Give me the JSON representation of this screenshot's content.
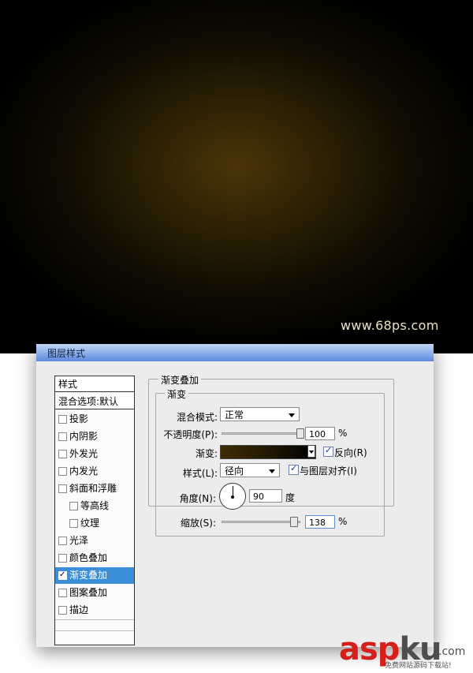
{
  "watermark_top": "www.68ps.com",
  "dialog": {
    "title": "图层样式",
    "styles_header": "样式",
    "blend_options": "混合选项:默认",
    "effects": [
      {
        "label": "投影",
        "checked": false,
        "indent": false,
        "selected": false
      },
      {
        "label": "内阴影",
        "checked": false,
        "indent": false,
        "selected": false
      },
      {
        "label": "外发光",
        "checked": false,
        "indent": false,
        "selected": false
      },
      {
        "label": "内发光",
        "checked": false,
        "indent": false,
        "selected": false
      },
      {
        "label": "斜面和浮雕",
        "checked": false,
        "indent": false,
        "selected": false
      },
      {
        "label": "等高线",
        "checked": false,
        "indent": true,
        "selected": false
      },
      {
        "label": "纹理",
        "checked": false,
        "indent": true,
        "selected": false
      },
      {
        "label": "光泽",
        "checked": false,
        "indent": false,
        "selected": false
      },
      {
        "label": "颜色叠加",
        "checked": false,
        "indent": false,
        "selected": false
      },
      {
        "label": "渐变叠加",
        "checked": true,
        "indent": false,
        "selected": true
      },
      {
        "label": "图案叠加",
        "checked": false,
        "indent": false,
        "selected": false
      },
      {
        "label": "描边",
        "checked": false,
        "indent": false,
        "selected": false
      }
    ],
    "gradient_overlay": {
      "group_title": "渐变叠加",
      "subgroup_title": "渐变",
      "blend_mode_label": "混合模式:",
      "blend_mode_value": "正常",
      "opacity_label": "不透明度(P):",
      "opacity_value": "100",
      "opacity_unit": "%",
      "opacity_fraction": 1.0,
      "gradient_label": "渐变:",
      "reverse_label": "反向(R)",
      "reverse_checked": true,
      "style_label": "样式(L):",
      "style_value": "径向",
      "align_label": "与图层对齐(I)",
      "align_checked": true,
      "angle_label": "角度(N):",
      "angle_value": "90",
      "angle_unit": "度",
      "scale_label": "缩放(S):",
      "scale_value": "138",
      "scale_unit": "%",
      "scale_fraction": 0.92
    }
  },
  "brand": {
    "part1": "asp",
    "part2": "ku",
    "suffix": ".com",
    "tagline": "免费网站源码下载站!"
  },
  "colors": {
    "selection": "#3a8fd8",
    "brand_red": "#d4201a",
    "canvas_center": "#4a3506"
  }
}
